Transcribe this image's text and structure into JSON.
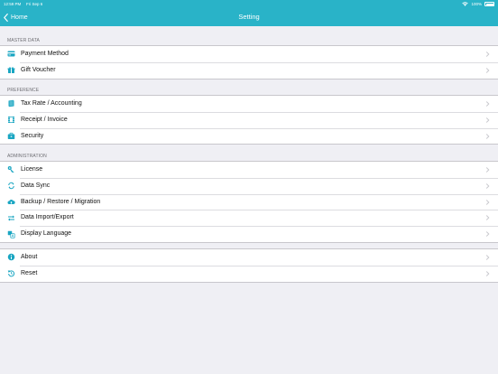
{
  "status_bar": {
    "time": "12:59 PM",
    "date": "Fri Sep 6",
    "battery": "100%"
  },
  "nav": {
    "back_label": "Home",
    "title": "Setting"
  },
  "sections": [
    {
      "header": "MASTER DATA",
      "items": [
        {
          "label": "Payment Method",
          "icon": "credit-card-icon"
        },
        {
          "label": "Gift Voucher",
          "icon": "gift-icon"
        }
      ]
    },
    {
      "header": "PREFERENCE",
      "items": [
        {
          "label": "Tax Rate / Accounting",
          "icon": "book-icon"
        },
        {
          "label": "Receipt / Invoice",
          "icon": "film-receipt-icon"
        },
        {
          "label": "Security",
          "icon": "briefcase-icon"
        }
      ]
    },
    {
      "header": "ADMINISTRATION",
      "items": [
        {
          "label": "License",
          "icon": "key-icon"
        },
        {
          "label": "Data Sync",
          "icon": "sync-icon"
        },
        {
          "label": "Backup / Restore / Migration",
          "icon": "cloud-icon"
        },
        {
          "label": "Data Import/Export",
          "icon": "transfer-icon"
        },
        {
          "label": "Display Language",
          "icon": "translate-icon"
        }
      ]
    },
    {
      "header": "",
      "items": [
        {
          "label": "About",
          "icon": "info-icon"
        },
        {
          "label": "Reset",
          "icon": "reset-icon"
        }
      ]
    }
  ],
  "colors": {
    "accent": "#29b3c8",
    "icon": "#1aa6c2",
    "background": "#efeff4"
  }
}
